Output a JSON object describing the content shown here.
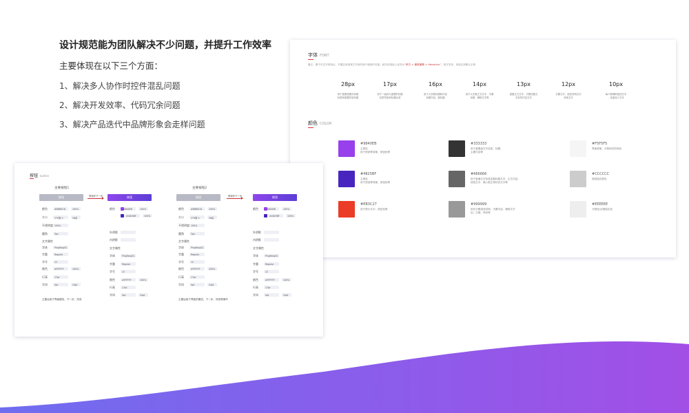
{
  "intro": {
    "heading": "设计规范能为团队解决不少问题，并提升工作效率",
    "subheading": "主要体现在以下三个方面：",
    "points": [
      "1、解决多人协作时控件混乱问题",
      "2、解决开发效率、代码冗余问题",
      "3、解决产品迭代中品牌形象会走样问题"
    ]
  },
  "font_card": {
    "title": "字体",
    "title_en": "FONT",
    "note_prefix": "备注：基于中文字体特点，不建议采用其它字体时用户使用时可能，就字体选用上优先为",
    "note_highlight": "“苹方 > 微软雅黑 > Helvetica”",
    "note_suffix": "，其次字体，采用正则默认字体",
    "sizes": [
      {
        "size": "28px",
        "desc": [
          "用于重要重要的标题",
          "标签和重要的型标题"
        ]
      },
      {
        "size": "17px",
        "desc": [
          "用于一级较为重要的标题",
          "标签导航和标题区域"
        ]
      },
      {
        "size": "16px",
        "desc": [
          "用于大多数标题和内容",
          "标题内容，副标题"
        ]
      },
      {
        "size": "14px",
        "desc": [
          "用于大多数正文文字，次要",
          "标题，辅助文字等"
        ]
      },
      {
        "size": "13px",
        "desc": [
          "重要正文文字，次要标题文",
          "字标的内容文字"
        ]
      },
      {
        "size": "12px",
        "desc": [
          "次要文字，描述说明文字",
          "其他文字"
        ]
      },
      {
        "size": "10px",
        "desc": [
          "每少数辅助描述文字",
          "，或者较少文字"
        ]
      }
    ],
    "color_title": "颜色",
    "color_title_en": "COLOR",
    "colors": [
      {
        "hex": "#9840EB",
        "color": "#9840EB",
        "desc": [
          "主颜色",
          "用于按钮等背景、按钮色等"
        ]
      },
      {
        "hex": "#333333",
        "color": "#333333",
        "desc": [
          "用于重要级文字信息、标题、",
          "主要内容等"
        ]
      },
      {
        "hex": "#F5F5F5",
        "color": "#F5F5F5",
        "desc": [
          "界面背景，分割填充的底色"
        ]
      },
      {
        "hex": "#4825BF",
        "color": "#4825BF",
        "desc": [
          "主颜色",
          "用于按钮等背景、按钮色等"
        ]
      },
      {
        "hex": "#666666",
        "color": "#666666",
        "desc": [
          "用于普通文字信息如副标题文字、正文内容、",
          "按钮文字、输入框正常状态文字等"
        ]
      },
      {
        "hex": "#CCCCCC",
        "color": "#CCCCCC",
        "desc": [
          "按钮描边颜色"
        ]
      },
      {
        "hex": "#EB3C27",
        "color": "#EB3C27",
        "desc": [
          "用于提示文字、按钮色等"
        ]
      },
      {
        "hex": "#999999",
        "color": "#999999",
        "desc": [
          "用在次要描述说明、次要内容、辅助文字",
          "如、日期、时间等"
        ]
      },
      {
        "hex": "#EEEEEE",
        "color": "#EEEEEE",
        "desc": [
          "分割线/边框描边色"
        ]
      }
    ]
  },
  "button_card": {
    "title": "按钮",
    "title_en": "button",
    "col_titles": [
      "主要按钮1",
      "主要按钮2"
    ],
    "pill_label": "按钮",
    "arrow_label": "再操作下一步",
    "left_labels": [
      "颜色",
      "大小",
      "不透明度",
      "圆角",
      "文字属性",
      "字体",
      "字重",
      "字号",
      "颜色",
      "行高",
      "字间"
    ],
    "right_labels": [
      "颜色",
      "外阴影",
      "内阴影",
      "文字属性",
      "字体",
      "字重",
      "字号",
      "颜色",
      "行高",
      "字间"
    ],
    "left_values": [
      "#BDBEC8",
      "100%",
      "270宽 ×",
      "28高",
      "100%",
      "3px",
      "PingFangSC",
      "Regular",
      "12",
      "#FFFFFF",
      "100%",
      "17pt",
      "0pt",
      "24pt"
    ],
    "right_values": [
      "#9840EB",
      "100%",
      "#4825BF",
      "100%",
      "PingFangSC",
      "Regular",
      "12",
      "#FFFFFF",
      "100%",
      "17pt",
      "0pt",
      "24pt"
    ],
    "footnotes": [
      "主要运用于界面模态、下一步、完成",
      "主要运用于界面的模态、下一步、完成等操作"
    ]
  }
}
